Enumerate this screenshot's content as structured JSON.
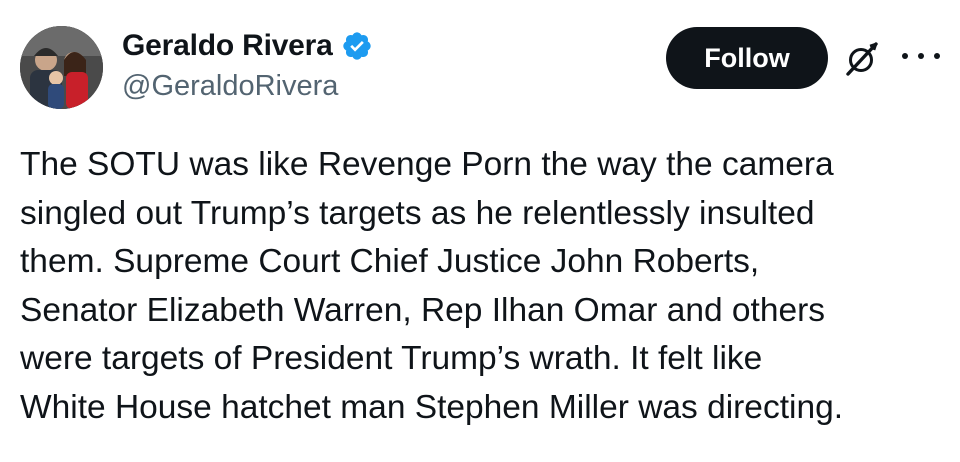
{
  "author": {
    "display_name": "Geraldo Rivera",
    "handle": "@GeraldoRivera",
    "verified": true,
    "verified_icon": "verified-badge-icon",
    "verified_color": "#1d9bf0"
  },
  "actions": {
    "follow_label": "Follow",
    "grok_icon": "grok-icon",
    "more_icon": "more-options-icon"
  },
  "tweet": {
    "lines": [
      "The SOTU was like Revenge Porn the way the camera",
      "singled out Trump’s targets as he relentlessly insulted",
      "them. Supreme Court Chief Justice John Roberts,",
      "Senator Elizabeth Warren, Rep Ilhan Omar and others",
      "were targets of President Trump’s wrath. It felt like",
      "White House hatchet man Stephen Miller was directing."
    ]
  },
  "colors": {
    "text_primary": "#0f1419",
    "text_secondary": "#536471",
    "button_bg": "#0f1419",
    "button_text": "#ffffff",
    "background": "#ffffff"
  }
}
